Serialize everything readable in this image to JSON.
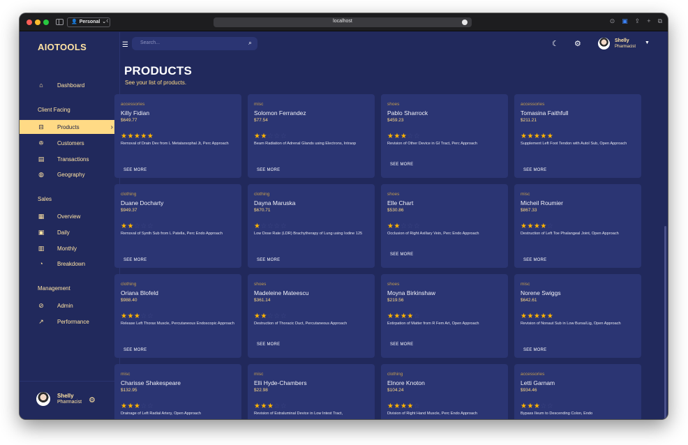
{
  "browser": {
    "profile": "Personal",
    "url": "localhost"
  },
  "brand": "AIOTOOLS",
  "nav": {
    "dashboard": "Dashboard",
    "client_facing": "Client Facing",
    "products": "Products",
    "customers": "Customers",
    "transactions": "Transactions",
    "geography": "Geography",
    "sales": "Sales",
    "overview": "Overview",
    "daily": "Daily",
    "monthly": "Monthly",
    "breakdown": "Breakdown",
    "management": "Management",
    "admin": "Admin",
    "performance": "Performance"
  },
  "user": {
    "name": "Shelly",
    "role": "Pharmacist"
  },
  "search": {
    "placeholder": "Search..."
  },
  "header": {
    "title": "PRODUCTS",
    "subtitle": "See your list of products."
  },
  "see_more": "SEE MORE",
  "products": [
    {
      "category": "accessories",
      "name": "Killy Fidian",
      "price": "$649.77",
      "rating": 5,
      "desc": "Removal of Drain Dev from L Metatarsophal Jt, Perc Approach"
    },
    {
      "category": "misc",
      "name": "Solomon Ferrandez",
      "price": "$77.54",
      "rating": 2,
      "desc": "Beam Radiation of Adrenal Glands using Electrons, Intraop"
    },
    {
      "category": "shoes",
      "name": "Pablo Sharrock",
      "price": "$459.23",
      "rating": 3,
      "desc": "Revision of Other Device in GI Tract, Perc Approach"
    },
    {
      "category": "accessories",
      "name": "Tomasina Faithfull",
      "price": "$211.21",
      "rating": 5,
      "desc": "Supplement Left Foot Tendon with Autol Sub, Open Approach"
    },
    {
      "category": "clothing",
      "name": "Duane Docharty",
      "price": "$949.37",
      "rating": 2,
      "desc": "Removal of Synth Sub from L Patella, Perc Endo Approach"
    },
    {
      "category": "clothing",
      "name": "Dayna Maruska",
      "price": "$670.71",
      "rating": 1,
      "desc": "Low Dose Rate (LDR) Brachytherapy of Lung using Iodine 125"
    },
    {
      "category": "shoes",
      "name": "Elle Chart",
      "price": "$530.86",
      "rating": 2,
      "desc": "Occlusion of Right Axillary Vein, Perc Endo Approach"
    },
    {
      "category": "misc",
      "name": "Micheil Roumier",
      "price": "$867.33",
      "rating": 4,
      "desc": "Destruction of Left Toe Phalangeal Joint, Open Approach"
    },
    {
      "category": "clothing",
      "name": "Oriana Blofeld",
      "price": "$988.40",
      "rating": 3,
      "desc": "Release Left Thorax Muscle, Percutaneous Endoscopic Approach"
    },
    {
      "category": "shoes",
      "name": "Madeleine Mateescu",
      "price": "$361.14",
      "rating": 2,
      "desc": "Destruction of Thoracic Duct, Percutaneous Approach"
    },
    {
      "category": "shoes",
      "name": "Moyna Birkinshaw",
      "price": "$219.56",
      "rating": 4,
      "desc": "Extirpation of Matter from R Fem Art, Open Approach"
    },
    {
      "category": "misc",
      "name": "Norene Swiggs",
      "price": "$642.61",
      "rating": 5,
      "desc": "Revision of Nonaut Sub in Low Bursa/Lig, Open Approach"
    },
    {
      "category": "misc",
      "name": "Charisse Shakespeare",
      "price": "$132.95",
      "rating": 3,
      "desc": "Drainage of Left Radial Artery, Open Approach"
    },
    {
      "category": "misc",
      "name": "Elli Hyde-Chambers",
      "price": "$22.98",
      "rating": 3,
      "desc": "Revision of Extraluminal Device in Low Intest Tract,"
    },
    {
      "category": "clothing",
      "name": "Elnore Knoton",
      "price": "$104.24",
      "rating": 4,
      "desc": "Division of Right Hand Muscle, Perc Endo Approach"
    },
    {
      "category": "accessories",
      "name": "Letti Garnam",
      "price": "$934.46",
      "rating": 3,
      "desc": "Bypass Ileum to Descending Colon, Endo"
    }
  ],
  "colors": {
    "background": "#21295c",
    "card": "#2b3573",
    "accent": "#ffda85",
    "star": "#ffb400"
  }
}
